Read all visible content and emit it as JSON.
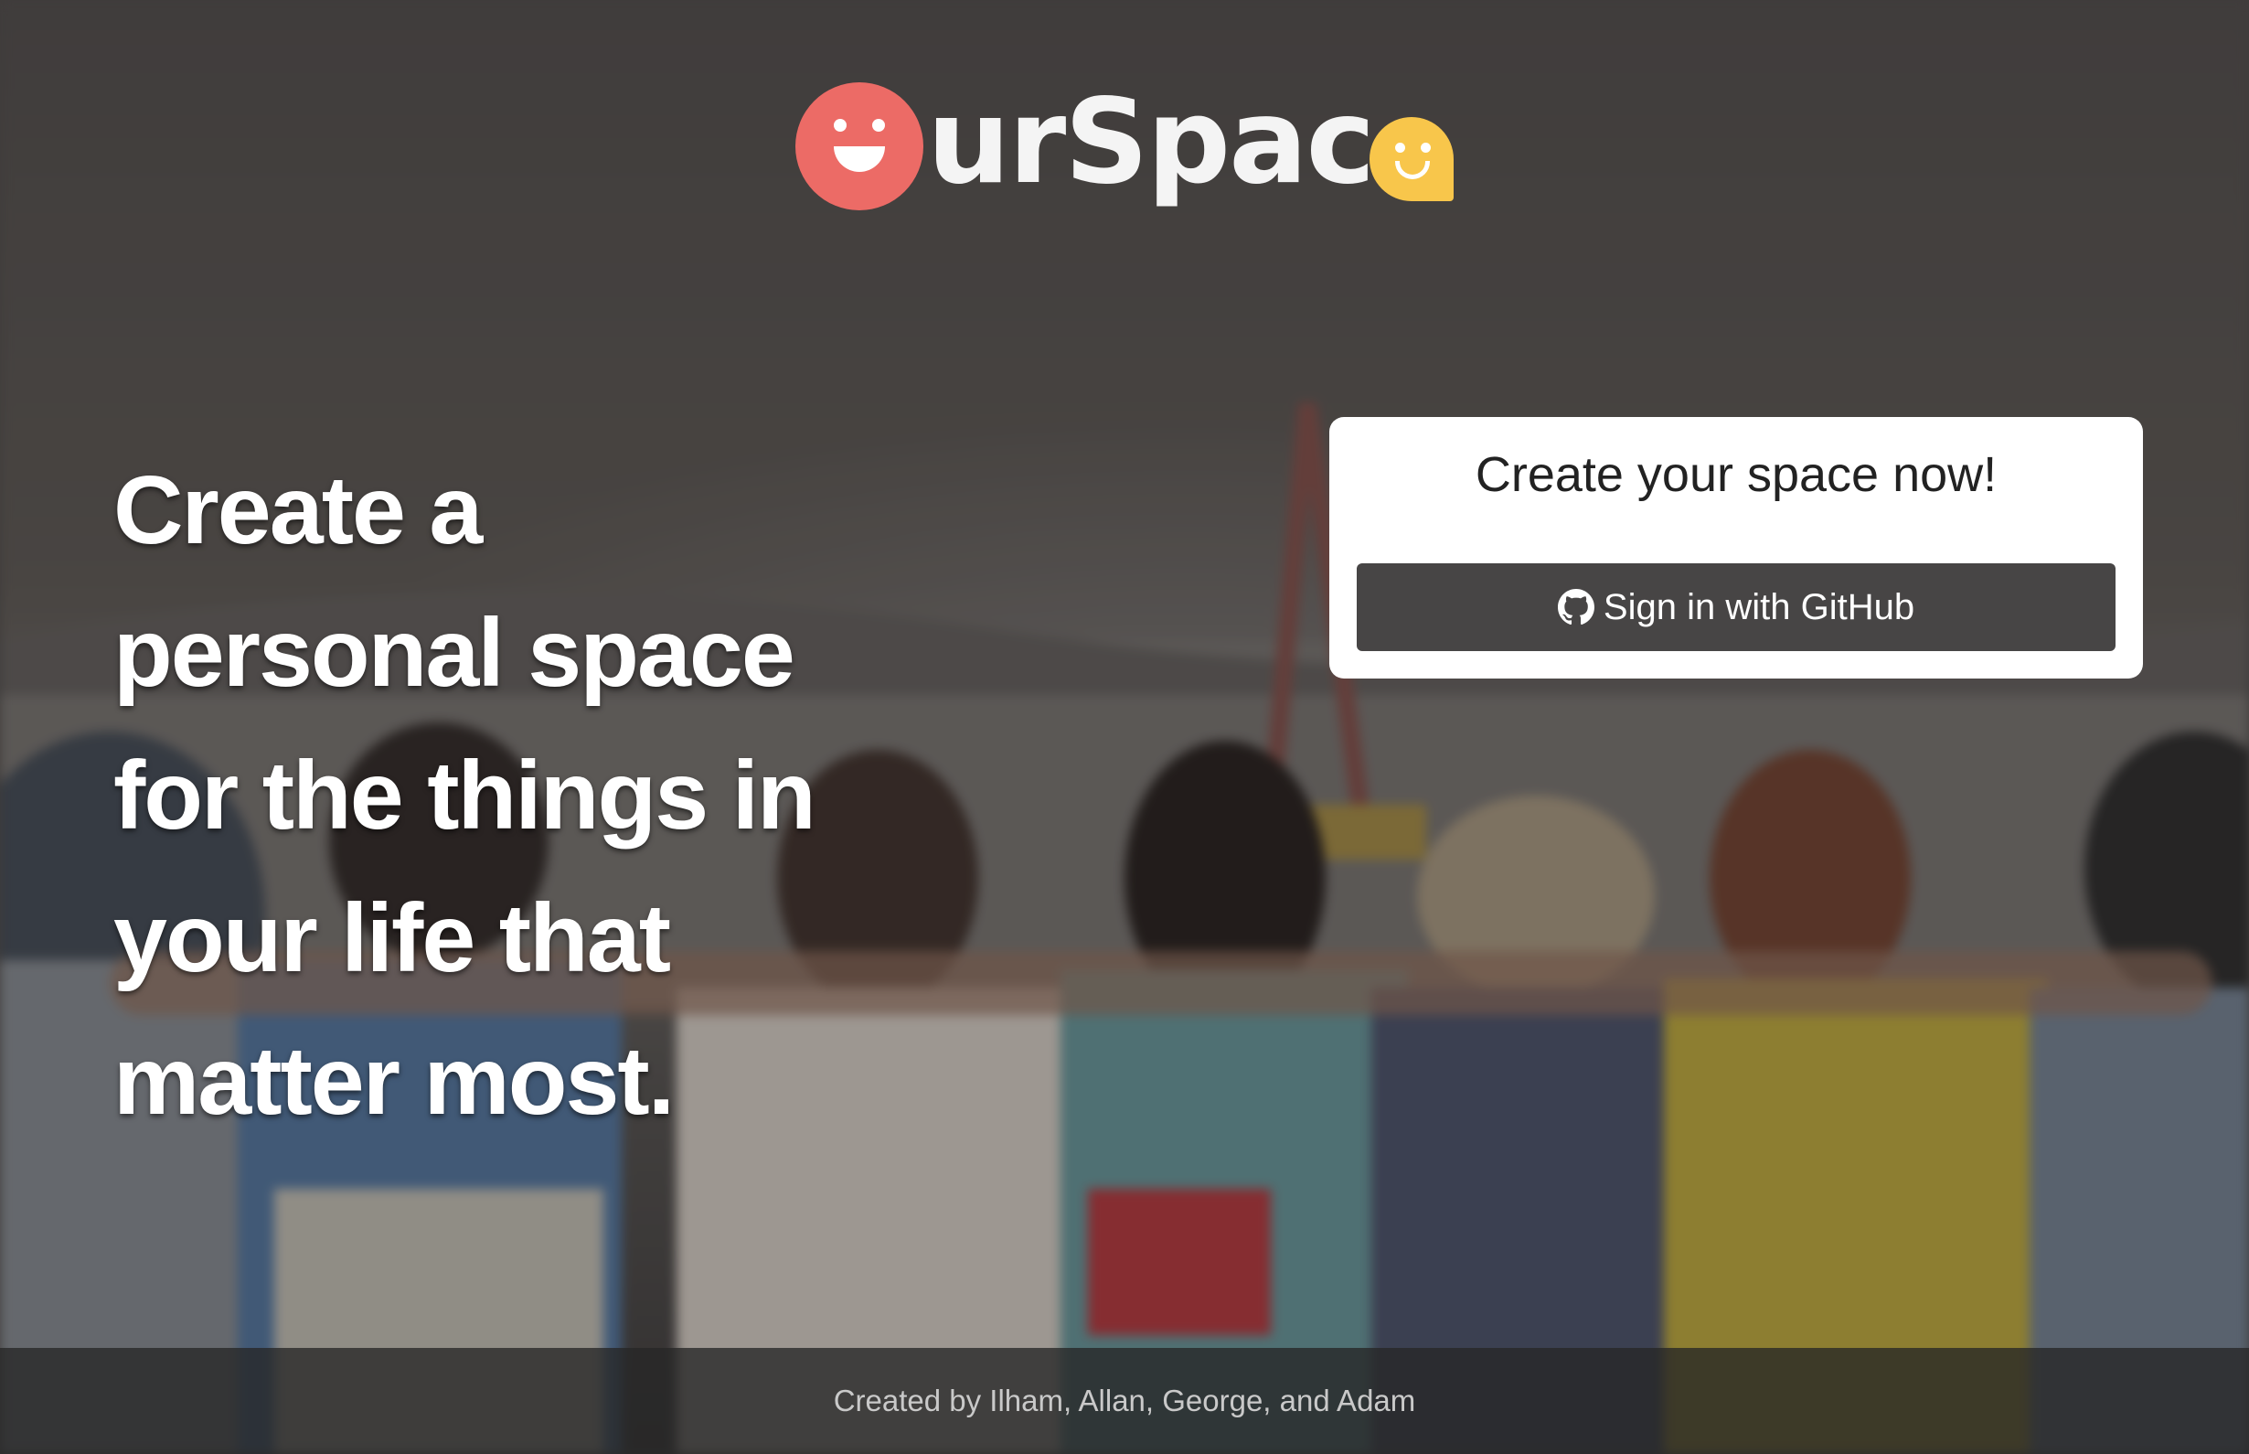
{
  "logo": {
    "text": "urSpac",
    "alt": "OurSpace",
    "colors": {
      "face": "#ec6b66",
      "bubble": "#f8c64b",
      "text": "#f4f4f4"
    }
  },
  "hero": {
    "line1": "Create a",
    "line2": "personal space",
    "line3": "for the things in",
    "line4": "your life that",
    "line5": "matter most."
  },
  "card": {
    "title": "Create your space now!",
    "button_label": "Sign in with GitHub",
    "button_icon": "github-icon",
    "button_color": "#474545"
  },
  "footer": {
    "text": "Created by Ilham, Allan, George, and Adam"
  },
  "background": {
    "description_icon": "group-photo-background"
  }
}
